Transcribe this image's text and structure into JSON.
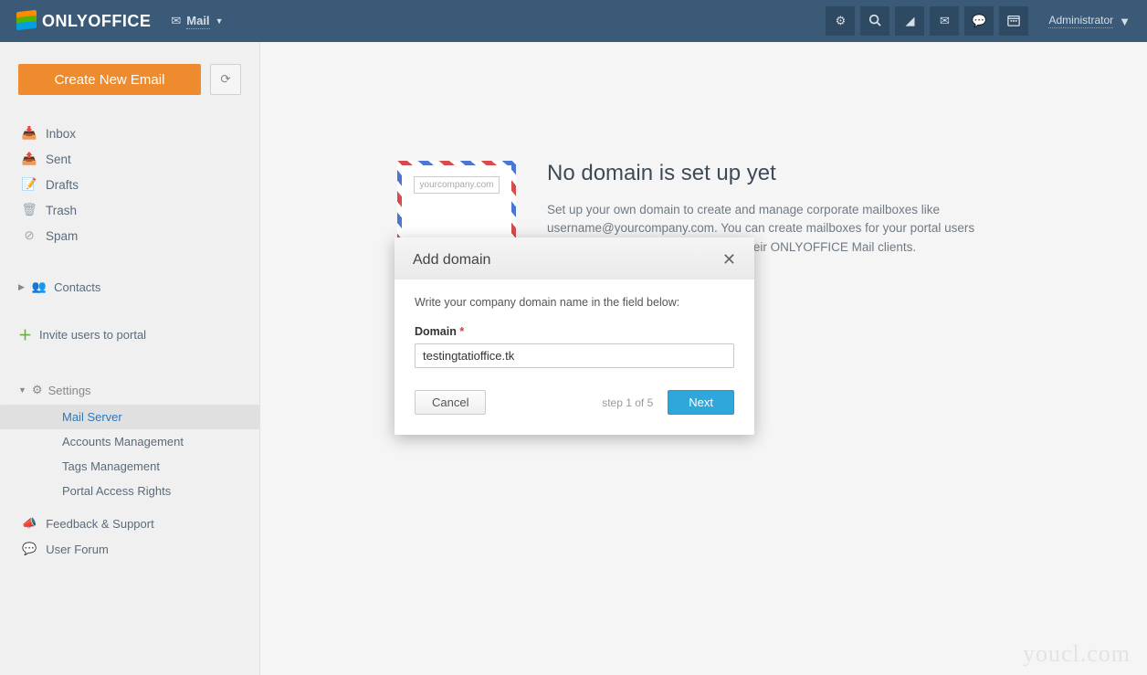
{
  "header": {
    "brand": "ONLYOFFICE",
    "module": "Mail",
    "user": "Administrator"
  },
  "sidebar": {
    "compose": "Create New Email",
    "folders": [
      {
        "label": "Inbox"
      },
      {
        "label": "Sent"
      },
      {
        "label": "Drafts"
      },
      {
        "label": "Trash"
      },
      {
        "label": "Spam"
      }
    ],
    "contacts": "Contacts",
    "invite": "Invite users to portal",
    "settings_label": "Settings",
    "settings_items": [
      {
        "label": "Mail Server",
        "active": true
      },
      {
        "label": "Accounts Management",
        "active": false
      },
      {
        "label": "Tags Management",
        "active": false
      },
      {
        "label": "Portal Access Rights",
        "active": false
      }
    ],
    "feedback": "Feedback & Support",
    "forum": "User Forum"
  },
  "main": {
    "postcard_domain": "yourcompany.com",
    "title": "No domain is set up yet",
    "desc": "Set up your own domain to create and manage corporate mailboxes like username@yourcompany.com. You can create mailboxes for your portal users and they will be able to use them in their ONLYOFFICE Mail clients."
  },
  "modal": {
    "title": "Add domain",
    "instruction": "Write your company domain name in the field below:",
    "field_label": "Domain",
    "domain_value": "testingtatioffice.tk",
    "cancel": "Cancel",
    "step": "step 1 of 5",
    "next": "Next"
  },
  "watermark": "youcl.com"
}
